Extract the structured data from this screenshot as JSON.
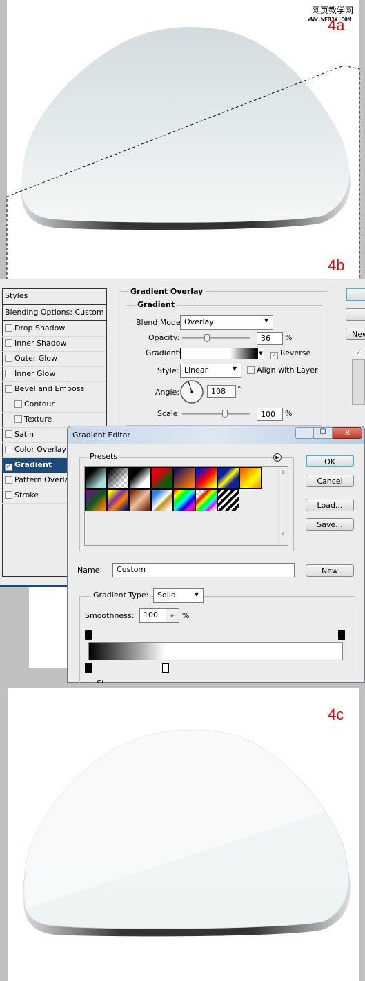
{
  "watermark": {
    "line1": "网页教学网",
    "line2": "WWW.WEBJX.COM"
  },
  "steps": {
    "a": "4a",
    "b": "4b",
    "c": "4c"
  },
  "layer_style": {
    "styles_header": "Styles",
    "blending": "Blending Options: Custom",
    "items": [
      {
        "label": "Drop Shadow",
        "checked": false,
        "indent": false
      },
      {
        "label": "Inner Shadow",
        "checked": false,
        "indent": false
      },
      {
        "label": "Outer Glow",
        "checked": false,
        "indent": false
      },
      {
        "label": "Inner Glow",
        "checked": false,
        "indent": false
      },
      {
        "label": "Bevel and Emboss",
        "checked": false,
        "indent": false
      },
      {
        "label": "Contour",
        "checked": false,
        "indent": true
      },
      {
        "label": "Texture",
        "checked": false,
        "indent": true
      },
      {
        "label": "Satin",
        "checked": false,
        "indent": false
      },
      {
        "label": "Color Overlay",
        "checked": false,
        "indent": false
      },
      {
        "label": "Gradient Ove",
        "checked": true,
        "indent": false,
        "selected": true
      },
      {
        "label": "Pattern Overlay",
        "checked": false,
        "indent": false
      },
      {
        "label": "Stroke",
        "checked": false,
        "indent": false
      }
    ],
    "section_title": "Gradient Overlay",
    "group_title": "Gradient",
    "blend_mode_label": "Blend Mode:",
    "blend_mode": "Overlay",
    "opacity_label": "Opacity:",
    "opacity": "36",
    "opacity_unit": "%",
    "gradient_label": "Gradient:",
    "reverse_label": "Reverse",
    "reverse": true,
    "style_label": "Style:",
    "style": "Linear",
    "align_label": "Align with Layer",
    "align": false,
    "angle_label": "Angle:",
    "angle": "108",
    "angle_unit": "°",
    "scale_label": "Scale:",
    "scale": "100",
    "scale_unit": "%",
    "new_button": "New"
  },
  "gradient_editor": {
    "title": "Gradient Editor",
    "presets_label": "Presets",
    "ok": "OK",
    "cancel": "Cancel",
    "load": "Load...",
    "save": "Save...",
    "name_label": "Name:",
    "name_value": "Custom",
    "new_button": "New",
    "type_label": "Gradient Type:",
    "type_value": "Solid",
    "smooth_label": "Smoothness:",
    "smooth_value": "100",
    "smooth_unit": "%",
    "truncated_label": "St"
  },
  "colors": {
    "selection": "#1c4a7a",
    "accent_red": "#e00000",
    "panel": "#ececec"
  }
}
